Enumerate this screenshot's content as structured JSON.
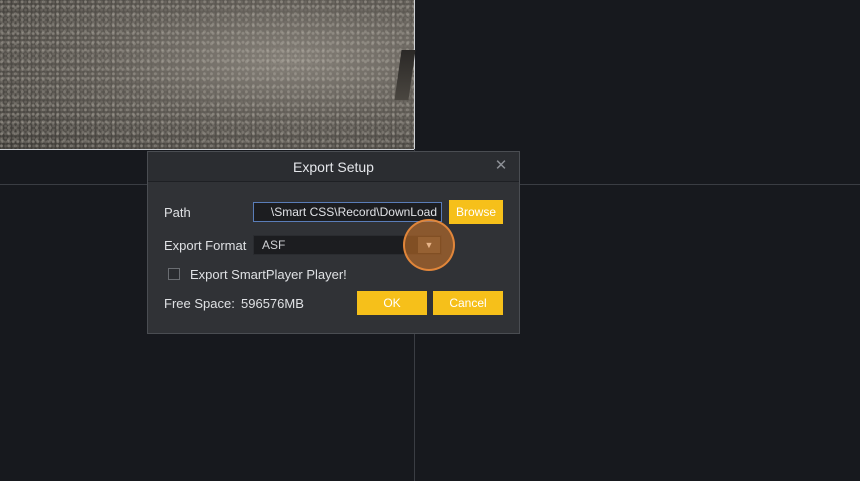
{
  "dialog": {
    "title": "Export Setup",
    "close_icon": "close-icon",
    "path_label": "Path",
    "path_value": "Smart CSS\\Record\\DownLoad\\",
    "browse_label": "Browse",
    "format_label": "Export Format",
    "format_selected": "ASF",
    "dropdown_icon": "chevron-down-icon",
    "export_player_label": "Export SmartPlayer Player!",
    "export_player_checked": false,
    "free_space_label": "Free Space:",
    "free_space_value": "596576MB",
    "ok_label": "OK",
    "cancel_label": "Cancel"
  },
  "colors": {
    "accent": "#f6c01a",
    "background": "#17191e",
    "dialog_bg": "#303236",
    "cursor_highlight": "#d6782a"
  }
}
